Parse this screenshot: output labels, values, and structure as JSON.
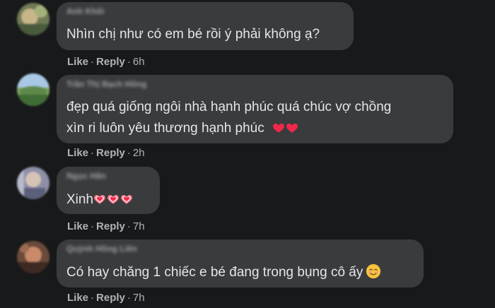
{
  "comments": [
    {
      "author": "Anh Khôi",
      "lines": [
        "Nhìn chị như có em bé rồi ý phải không ạ?"
      ],
      "like": "Like",
      "reply": "Reply",
      "time": "6h"
    },
    {
      "author": "Trần Thị Bạch Hồng",
      "lines": [
        "đẹp quá giống ngôi nhà hạnh phúc quá chúc vợ chồng",
        "xìn ri luôn yêu thương hạnh phúc"
      ],
      "like": "Like",
      "reply": "Reply",
      "time": "2h"
    },
    {
      "author": "Ngọc Hân",
      "lines": [
        "Xinh"
      ],
      "like": "Like",
      "reply": "Reply",
      "time": "7h"
    },
    {
      "author": "Quỳnh Hồng Liên",
      "lines": [
        "Có hay chăng 1 chiếc e bé đang trong bụng cô ấy"
      ],
      "like": "Like",
      "reply": "Reply",
      "time": "7h"
    }
  ],
  "separator": "·",
  "colors": {
    "background": "#18191a",
    "bubble": "#3a3b3c",
    "text": "#e4e6eb",
    "meta": "#b0b3b8",
    "heart": "#f02849"
  },
  "icons": {
    "red_heart": "red-heart-icon",
    "pink_heart": "heart-with-ribbon-icon",
    "smile": "smiling-face-icon"
  }
}
